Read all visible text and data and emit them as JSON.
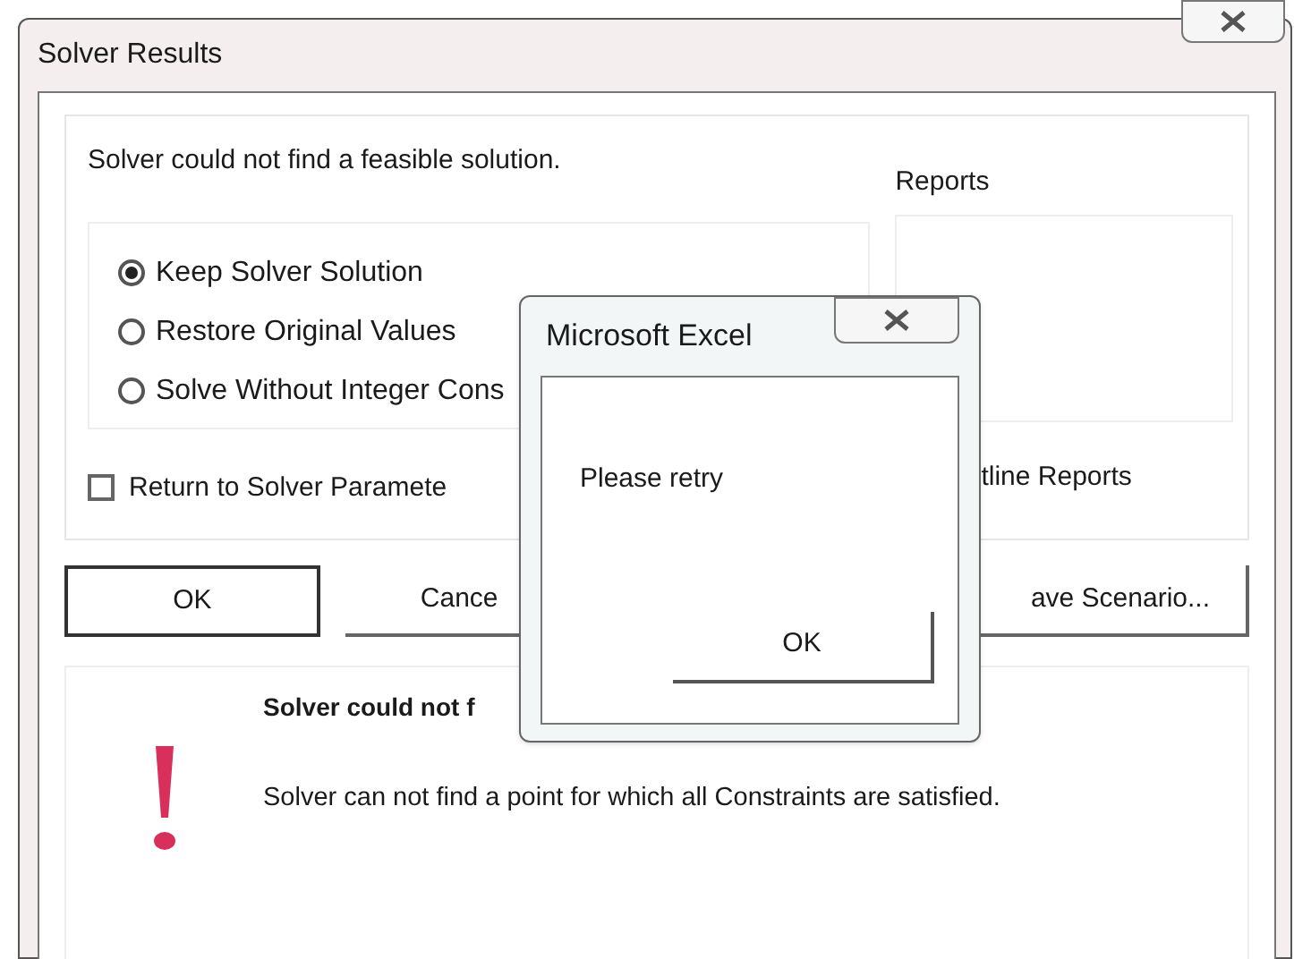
{
  "window": {
    "title": "Solver Results"
  },
  "message": "Solver could not find a feasible solution.",
  "options": [
    {
      "label": "Keep Solver Solution",
      "selected": true
    },
    {
      "label": "Restore Original Values",
      "selected": false
    },
    {
      "label": "Solve Without Integer Cons",
      "selected": false
    }
  ],
  "reports": {
    "label": "Reports"
  },
  "return_checkbox": {
    "label": "Return to Solver Paramete",
    "checked": false
  },
  "outline_reports": {
    "label": "tline Reports"
  },
  "buttons": [
    {
      "label": "OK",
      "kind": "default"
    },
    {
      "label": "Cance",
      "kind": "normal"
    },
    {
      "label": "ave Scenario...",
      "kind": "normal"
    }
  ],
  "details": {
    "title": "Solver could not f",
    "text": "Solver can not find a point for which all Constraints are satisfied."
  },
  "alert": {
    "title": "Microsoft Excel",
    "message": "Please retry",
    "button": "OK"
  }
}
